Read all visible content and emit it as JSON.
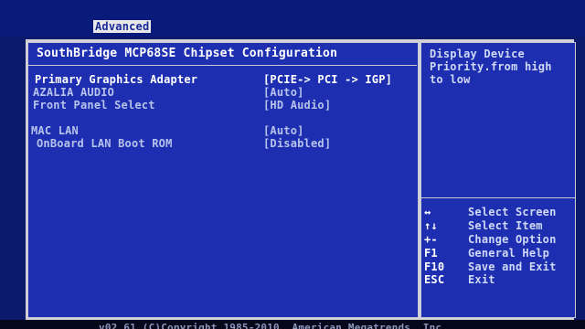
{
  "header": {
    "active_tab": "Advanced"
  },
  "section_title": "SouthBridge MCP68SE Chipset Configuration",
  "settings": [
    {
      "label": "Primary Graphics Adapter",
      "value": "[PCIE-> PCI -> IGP]",
      "selected": true
    },
    {
      "label": "AZALIA AUDIO",
      "value": "[Auto]",
      "selected": false
    },
    {
      "label": "Front Panel Select",
      "value": "[HD Audio]",
      "selected": false
    },
    {
      "label": "MAC LAN",
      "value": "[Auto]",
      "selected": false
    },
    {
      "label": "OnBoard LAN Boot ROM",
      "value": "[Disabled]",
      "selected": false
    }
  ],
  "help": {
    "description": "Display Device Priority.from high to low",
    "legend": [
      {
        "key": "↔",
        "action": "Select Screen"
      },
      {
        "key": "↑↓",
        "action": "Select Item"
      },
      {
        "key": "+-",
        "action": "Change Option"
      },
      {
        "key": "F1",
        "action": "General Help"
      },
      {
        "key": "F10",
        "action": "Save and Exit"
      },
      {
        "key": "ESC",
        "action": "Exit"
      }
    ]
  },
  "footer": {
    "text": "v02.61 (C)Copyright 1985-2010, American Megatrends, Inc."
  },
  "colors": {
    "background": "#0b1a6a",
    "pane": "#1d2fb0",
    "frame": "#d3d3d7",
    "text_normal": "#b7c3ea",
    "text_selected": "#ffffff"
  }
}
